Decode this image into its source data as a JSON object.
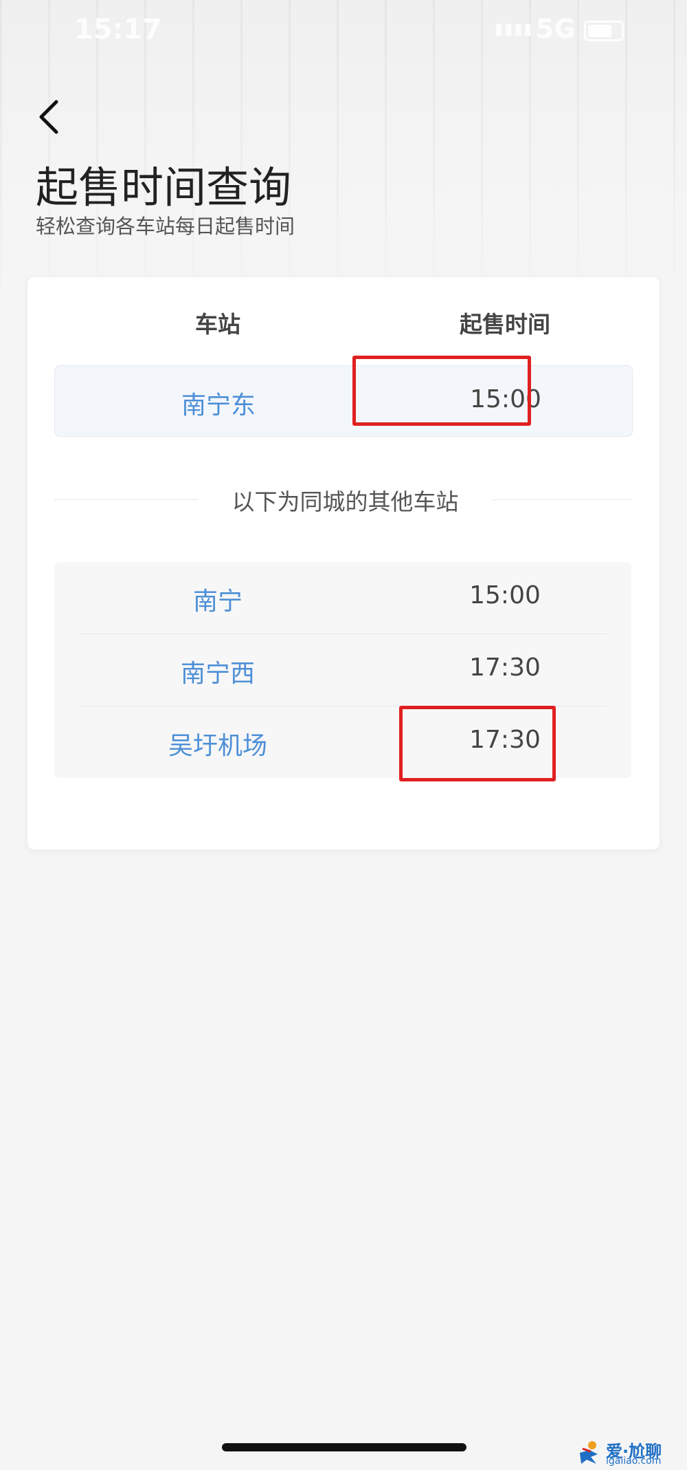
{
  "status_bar": {
    "time": "15:17",
    "network": "5G",
    "signal_icon": "signal-bars-icon",
    "battery_icon": "battery-icon"
  },
  "header": {
    "back_icon": "chevron-left-icon",
    "title": "起售时间查询",
    "subtitle": "轻松查询各车站每日起售时间"
  },
  "table": {
    "col_station": "车站",
    "col_time": "起售时间",
    "primary": {
      "station": "南宁东",
      "time": "15:00"
    },
    "divider": "以下为同城的其他车站",
    "others": [
      {
        "station": "南宁",
        "time": "15:00"
      },
      {
        "station": "南宁西",
        "time": "17:30"
      },
      {
        "station": "吴圩机场",
        "time": "17:30"
      }
    ]
  },
  "annotation_color": "#e02020",
  "link_color": "#4d8fd6",
  "watermark": {
    "name": "爱·尬聊",
    "url": "igaliao.com"
  }
}
